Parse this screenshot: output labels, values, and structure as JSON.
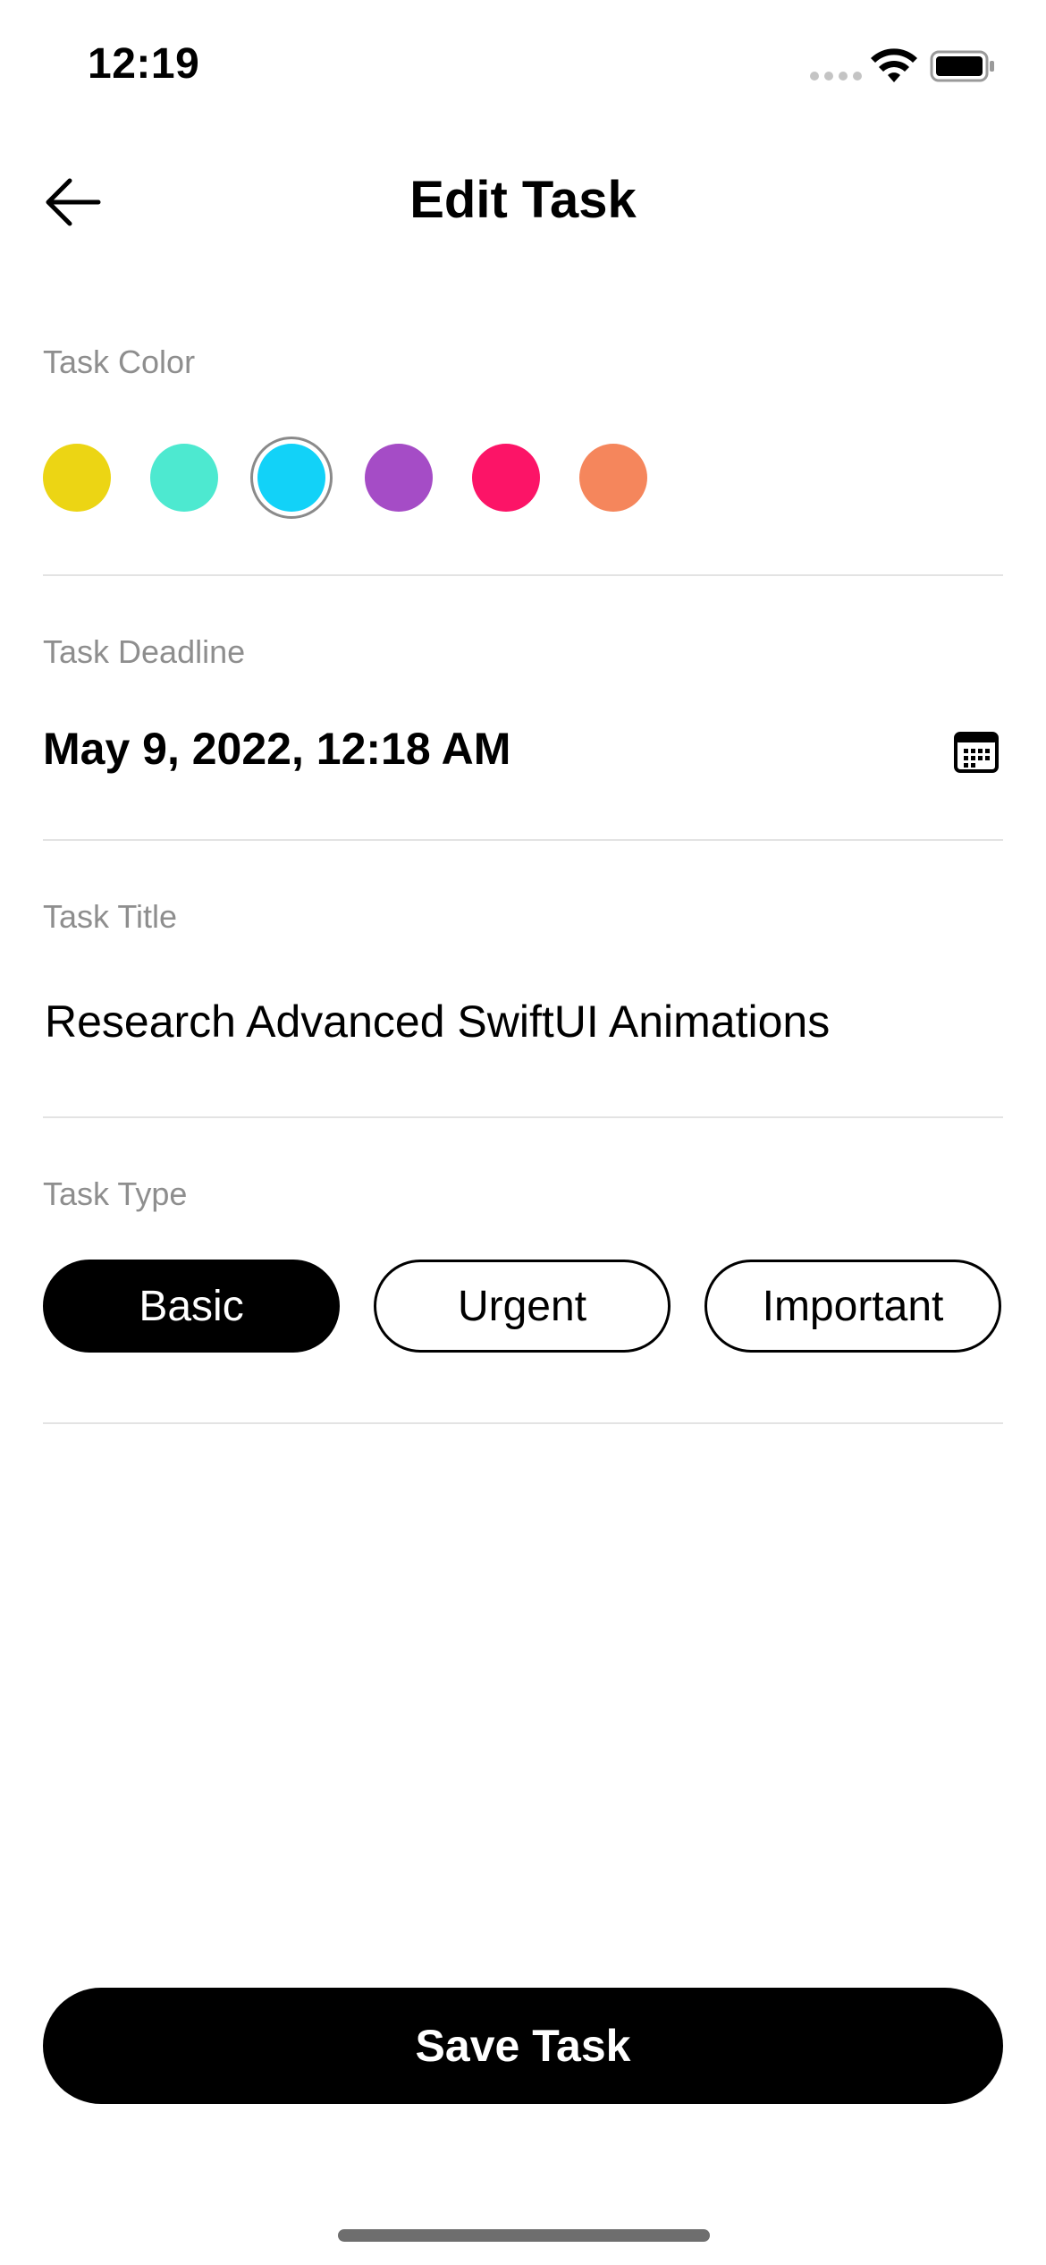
{
  "status_bar": {
    "time": "12:19"
  },
  "nav": {
    "title": "Edit Task",
    "back_icon": "arrow-left-icon"
  },
  "task_color": {
    "label": "Task Color",
    "options": [
      "#ecd514",
      "#4de9d0",
      "#12d2f8",
      "#a54cc6",
      "#fc1467",
      "#f5865c"
    ],
    "selected_index": 2
  },
  "task_deadline": {
    "label": "Task Deadline",
    "value": "May 9, 2022, 12:18 AM",
    "icon": "calendar-icon"
  },
  "task_title": {
    "label": "Task Title",
    "value": "Research Advanced SwiftUI Animations"
  },
  "task_type": {
    "label": "Task Type",
    "options": [
      "Basic",
      "Urgent",
      "Important"
    ],
    "selected": "Basic"
  },
  "save_button": {
    "label": "Save Task"
  }
}
